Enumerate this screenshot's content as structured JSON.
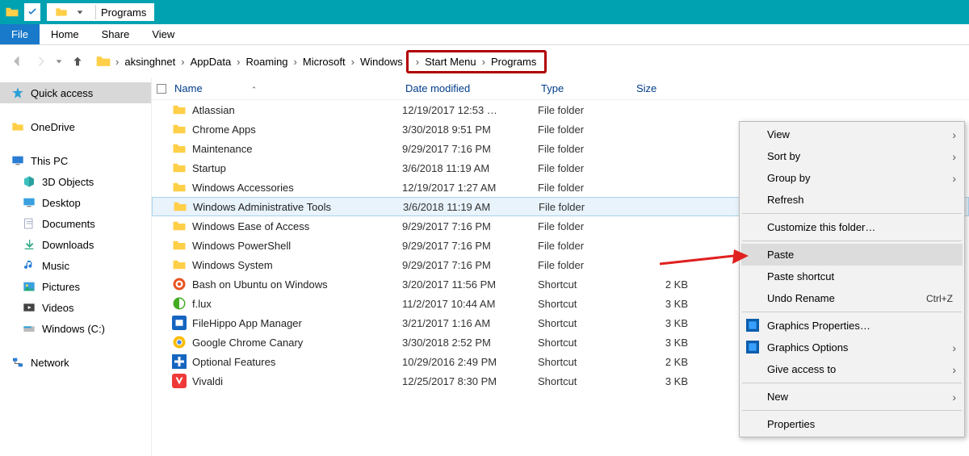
{
  "titlebar": {
    "title": "Programs"
  },
  "ribbon": {
    "file": "File",
    "home": "Home",
    "share": "Share",
    "view": "View"
  },
  "breadcrumb": [
    "aksinghnet",
    "AppData",
    "Roaming",
    "Microsoft",
    "Windows",
    "Start Menu",
    "Programs"
  ],
  "columns": {
    "name": "Name",
    "date": "Date modified",
    "type": "Type",
    "size": "Size"
  },
  "sidebar": {
    "quick_access": "Quick access",
    "onedrive": "OneDrive",
    "this_pc": "This PC",
    "pc_children": [
      "3D Objects",
      "Desktop",
      "Documents",
      "Downloads",
      "Music",
      "Pictures",
      "Videos",
      "Windows (C:)"
    ],
    "network": "Network"
  },
  "rows": [
    {
      "name": "Atlassian",
      "date": "12/19/2017 12:53 …",
      "type": "File folder",
      "size": "",
      "icon": "folder"
    },
    {
      "name": "Chrome Apps",
      "date": "3/30/2018 9:51 PM",
      "type": "File folder",
      "size": "",
      "icon": "folder"
    },
    {
      "name": "Maintenance",
      "date": "9/29/2017 7:16 PM",
      "type": "File folder",
      "size": "",
      "icon": "folder"
    },
    {
      "name": "Startup",
      "date": "3/6/2018 11:19 AM",
      "type": "File folder",
      "size": "",
      "icon": "folder"
    },
    {
      "name": "Windows Accessories",
      "date": "12/19/2017 1:27 AM",
      "type": "File folder",
      "size": "",
      "icon": "folder"
    },
    {
      "name": "Windows Administrative Tools",
      "date": "3/6/2018 11:19 AM",
      "type": "File folder",
      "size": "",
      "icon": "folder",
      "selected": true
    },
    {
      "name": "Windows Ease of Access",
      "date": "9/29/2017 7:16 PM",
      "type": "File folder",
      "size": "",
      "icon": "folder"
    },
    {
      "name": "Windows PowerShell",
      "date": "9/29/2017 7:16 PM",
      "type": "File folder",
      "size": "",
      "icon": "folder"
    },
    {
      "name": "Windows System",
      "date": "9/29/2017 7:16 PM",
      "type": "File folder",
      "size": "",
      "icon": "folder"
    },
    {
      "name": "Bash on Ubuntu on Windows",
      "date": "3/20/2017 11:56 PM",
      "type": "Shortcut",
      "size": "2 KB",
      "icon": "bash"
    },
    {
      "name": "f.lux",
      "date": "11/2/2017 10:44 AM",
      "type": "Shortcut",
      "size": "3 KB",
      "icon": "flux"
    },
    {
      "name": "FileHippo App Manager",
      "date": "3/21/2017 1:16 AM",
      "type": "Shortcut",
      "size": "3 KB",
      "icon": "filehippo"
    },
    {
      "name": "Google Chrome Canary",
      "date": "3/30/2018 2:52 PM",
      "type": "Shortcut",
      "size": "3 KB",
      "icon": "chrome"
    },
    {
      "name": "Optional Features",
      "date": "10/29/2016 2:49 PM",
      "type": "Shortcut",
      "size": "2 KB",
      "icon": "optional"
    },
    {
      "name": "Vivaldi",
      "date": "12/25/2017 8:30 PM",
      "type": "Shortcut",
      "size": "3 KB",
      "icon": "vivaldi"
    }
  ],
  "context_menu": {
    "view": "View",
    "sortby": "Sort by",
    "groupby": "Group by",
    "refresh": "Refresh",
    "customize": "Customize this folder…",
    "paste": "Paste",
    "paste_shortcut": "Paste shortcut",
    "undo": "Undo Rename",
    "undo_key": "Ctrl+Z",
    "gfx_props": "Graphics Properties…",
    "gfx_opts": "Graphics Options",
    "give_access": "Give access to",
    "new": "New",
    "properties": "Properties"
  }
}
